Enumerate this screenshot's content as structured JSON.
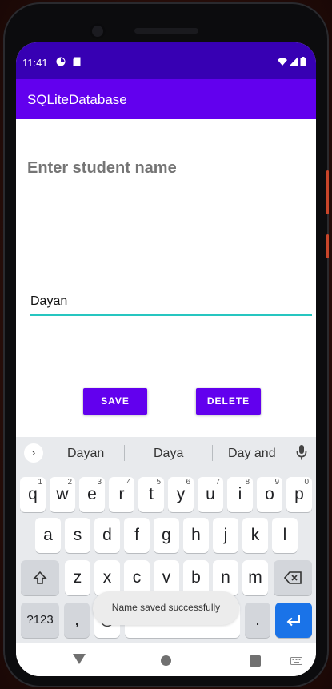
{
  "status": {
    "time": "11:41"
  },
  "app": {
    "title": "SQLiteDatabase"
  },
  "form": {
    "heading": "Enter student name",
    "input_value": "Dayan"
  },
  "buttons": {
    "save": "SAVE",
    "delete": "DELETE"
  },
  "keyboard": {
    "suggestions": [
      "Dayan",
      "Daya",
      "Day and"
    ],
    "row1": [
      {
        "k": "q",
        "h": "1"
      },
      {
        "k": "w",
        "h": "2"
      },
      {
        "k": "e",
        "h": "3"
      },
      {
        "k": "r",
        "h": "4"
      },
      {
        "k": "t",
        "h": "5"
      },
      {
        "k": "y",
        "h": "6"
      },
      {
        "k": "u",
        "h": "7"
      },
      {
        "k": "i",
        "h": "8"
      },
      {
        "k": "o",
        "h": "9"
      },
      {
        "k": "p",
        "h": "0"
      }
    ],
    "row2": [
      "a",
      "s",
      "d",
      "f",
      "g",
      "h",
      "j",
      "k",
      "l"
    ],
    "row3": [
      "z",
      "x",
      "c",
      "v",
      "b",
      "n",
      "m"
    ],
    "symbols_label": "?123",
    "comma": ",",
    "period": "."
  },
  "toast": {
    "message": "Name saved successfully"
  },
  "colors": {
    "statusbar": "#3700b3",
    "appbar": "#6200ee",
    "accent": "#26c6c0",
    "enter": "#1a73e8"
  }
}
